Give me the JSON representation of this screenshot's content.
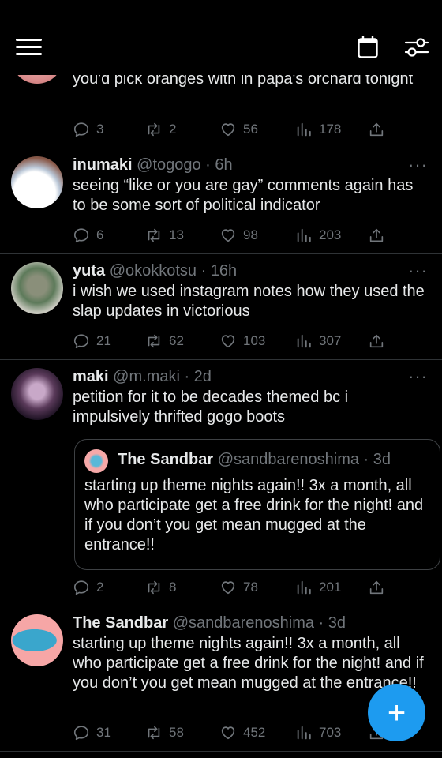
{
  "topbar": {
    "menu_icon": "hamburger-icon",
    "calendar_icon": "calendar-icon",
    "filter_icon": "sliders-icon"
  },
  "tweets": [
    {
      "body": "you'd pick oranges with in papa's orchard tonight",
      "replies": "3",
      "retweets": "2",
      "likes": "56",
      "views": "178"
    },
    {
      "name": "inumaki",
      "handle": "@togogo · 6h",
      "body": "seeing “like or you are gay” comments again has to be some sort of political indicator",
      "replies": "6",
      "retweets": "13",
      "likes": "98",
      "views": "203"
    },
    {
      "name": "yuta",
      "handle": "@okokkotsu · 16h",
      "body": "i wish we used instagram notes how they used the slap updates in victorious",
      "replies": "21",
      "retweets": "62",
      "likes": "103",
      "views": "307"
    },
    {
      "name": "maki",
      "handle": "@m.maki · 2d",
      "body": "petition for it to be decades themed bc i impulsively thrifted gogo boots",
      "quote": {
        "name": "The Sandbar",
        "handle": "@sandbarenoshima · 3d",
        "body": "starting up theme nights again!! 3x a month, all who participate get a free drink for the night! and if you don’t you get mean mugged at the entrance!!"
      },
      "replies": "2",
      "retweets": "8",
      "likes": "78",
      "views": "201"
    },
    {
      "name": "The Sandbar",
      "handle": "@sandbarenoshima · 3d",
      "body": "starting up theme nights again!! 3x a month, all who participate get a free drink for the night! and if you don’t you get mean mugged at the entrance!!",
      "replies": "31",
      "retweets": "58",
      "likes": "452",
      "views": "703"
    }
  ],
  "fab": {
    "label": "+"
  },
  "colors": {
    "background": "#000000",
    "text": "#e7e9ea",
    "muted": "#71767b",
    "accent": "#1d9bf0",
    "divider": "#2f3336"
  }
}
